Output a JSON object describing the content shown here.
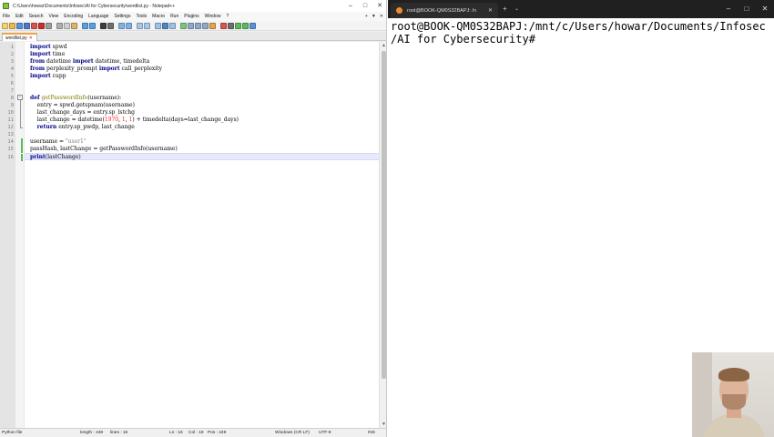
{
  "notepadpp": {
    "title": "C:\\Users\\howar\\Documents\\Infosec\\AI for Cybersecurity\\wordlist.py - Notepad++",
    "window_controls": [
      "–",
      "□",
      "✕"
    ],
    "menu": [
      "File",
      "Edit",
      "Search",
      "View",
      "Encoding",
      "Language",
      "Settings",
      "Tools",
      "Macro",
      "Run",
      "Plugins",
      "Window",
      "?"
    ],
    "menu_right": [
      "+",
      "▼",
      "✕"
    ],
    "tab": {
      "label": "wordlist.py",
      "close": "✕"
    },
    "code_lines": [
      {
        "num": "1",
        "text": "import spwd"
      },
      {
        "num": "2",
        "text": "import time"
      },
      {
        "num": "3",
        "text": "from datetime import datetime, timedelta"
      },
      {
        "num": "4",
        "text": "from perplexity_prompt import call_perplexity"
      },
      {
        "num": "5",
        "text": "import cupp"
      },
      {
        "num": "6",
        "text": ""
      },
      {
        "num": "7",
        "text": ""
      },
      {
        "num": "8",
        "text": "def getPasswordInfo(username):"
      },
      {
        "num": "9",
        "text": "    entry = spwd.getspnam(username)"
      },
      {
        "num": "10",
        "text": "    last_change_days = entry.sp_lstchg"
      },
      {
        "num": "11",
        "text": "    last_change = datetime(1970, 1, 1) + timedelta(days=last_change_days)"
      },
      {
        "num": "12",
        "text": "    return entry.sp_pwdp, last_change"
      },
      {
        "num": "13",
        "text": ""
      },
      {
        "num": "14",
        "text": "username = \"user1\""
      },
      {
        "num": "15",
        "text": "passHash, lastChange = getPasswordInfo(username)"
      },
      {
        "num": "16",
        "text": "print(lastChange)"
      }
    ],
    "status": {
      "file_type": "Python file",
      "length": "length : 448",
      "lines": "lines : 16",
      "ln": "Ln : 16",
      "col": "Col : 18",
      "pos": "Pos : 449",
      "eol": "Windows (CR LF)",
      "encoding": "UTF-8",
      "mode": "INS"
    }
  },
  "terminal": {
    "tab_title": "root@BOOK-QM0S32BAPJ: /n",
    "tab_close": "✕",
    "new_tab": "+",
    "dropdown": "⌄",
    "window_controls": [
      "–",
      "□",
      "✕"
    ],
    "lines": [
      "root@BOOK-QM0S32BAPJ:/mnt/c/Users/howar/Documents/Infosec",
      "/AI for Cybersecurity#"
    ]
  },
  "colors": {
    "keyword": "#00008b",
    "function_name": "#7a7a00",
    "string": "#7f7f7f",
    "number": "#ff2020",
    "current_line": "#e8e8ff",
    "terminal_titlebar": "#202020"
  }
}
